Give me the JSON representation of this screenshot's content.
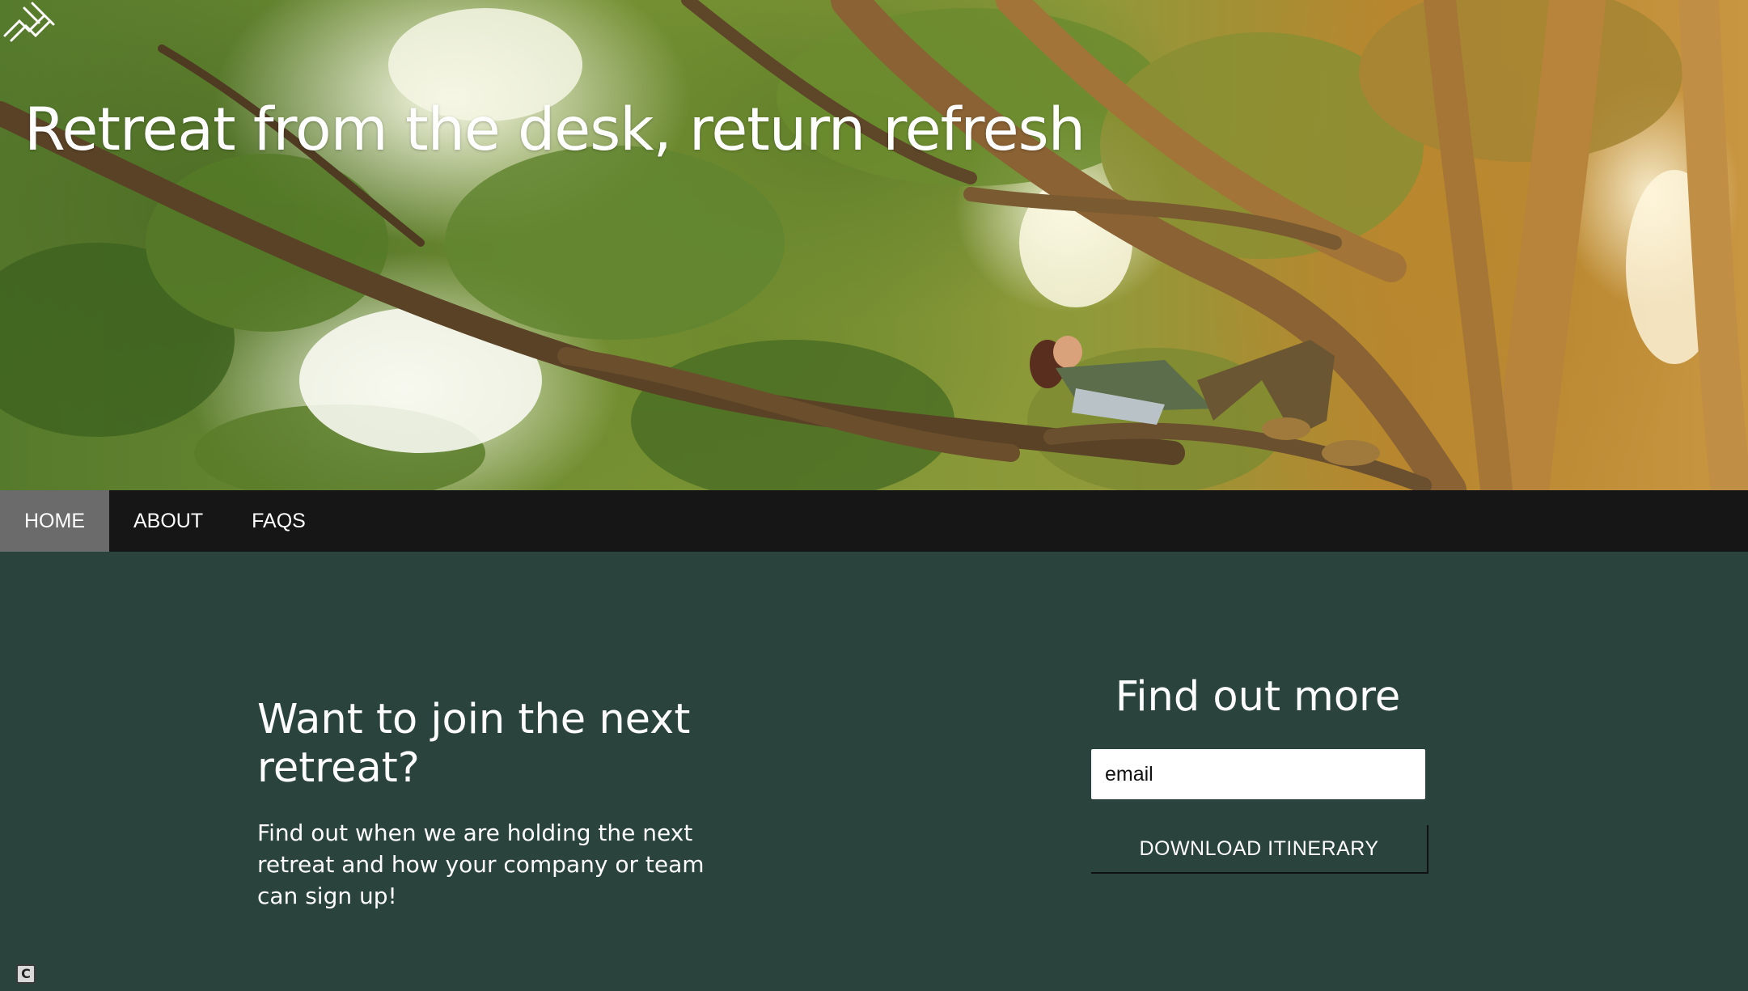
{
  "hero": {
    "title": "Retreat from the desk, return refresh",
    "image_description_icon": "person-resting-in-tree-image",
    "logo_icon": "site-logo-icon"
  },
  "nav": {
    "items": [
      {
        "label": "HOME",
        "active": true
      },
      {
        "label": "ABOUT",
        "active": false
      },
      {
        "label": "FAQS",
        "active": false
      }
    ]
  },
  "join": {
    "heading": "Want to join the next retreat?",
    "text": "Find out when we are holding the next retreat and how your company or team can sign up!"
  },
  "signup": {
    "heading": "Find out more",
    "email_placeholder": "email",
    "email_value": "",
    "button_label": "DOWNLOAD ITINERARY"
  },
  "corner_badge": {
    "label": "C"
  },
  "colors": {
    "nav_background": "#161616",
    "nav_active": "#6b6b6b",
    "content_background": "#2a433c",
    "text": "#ffffff"
  }
}
